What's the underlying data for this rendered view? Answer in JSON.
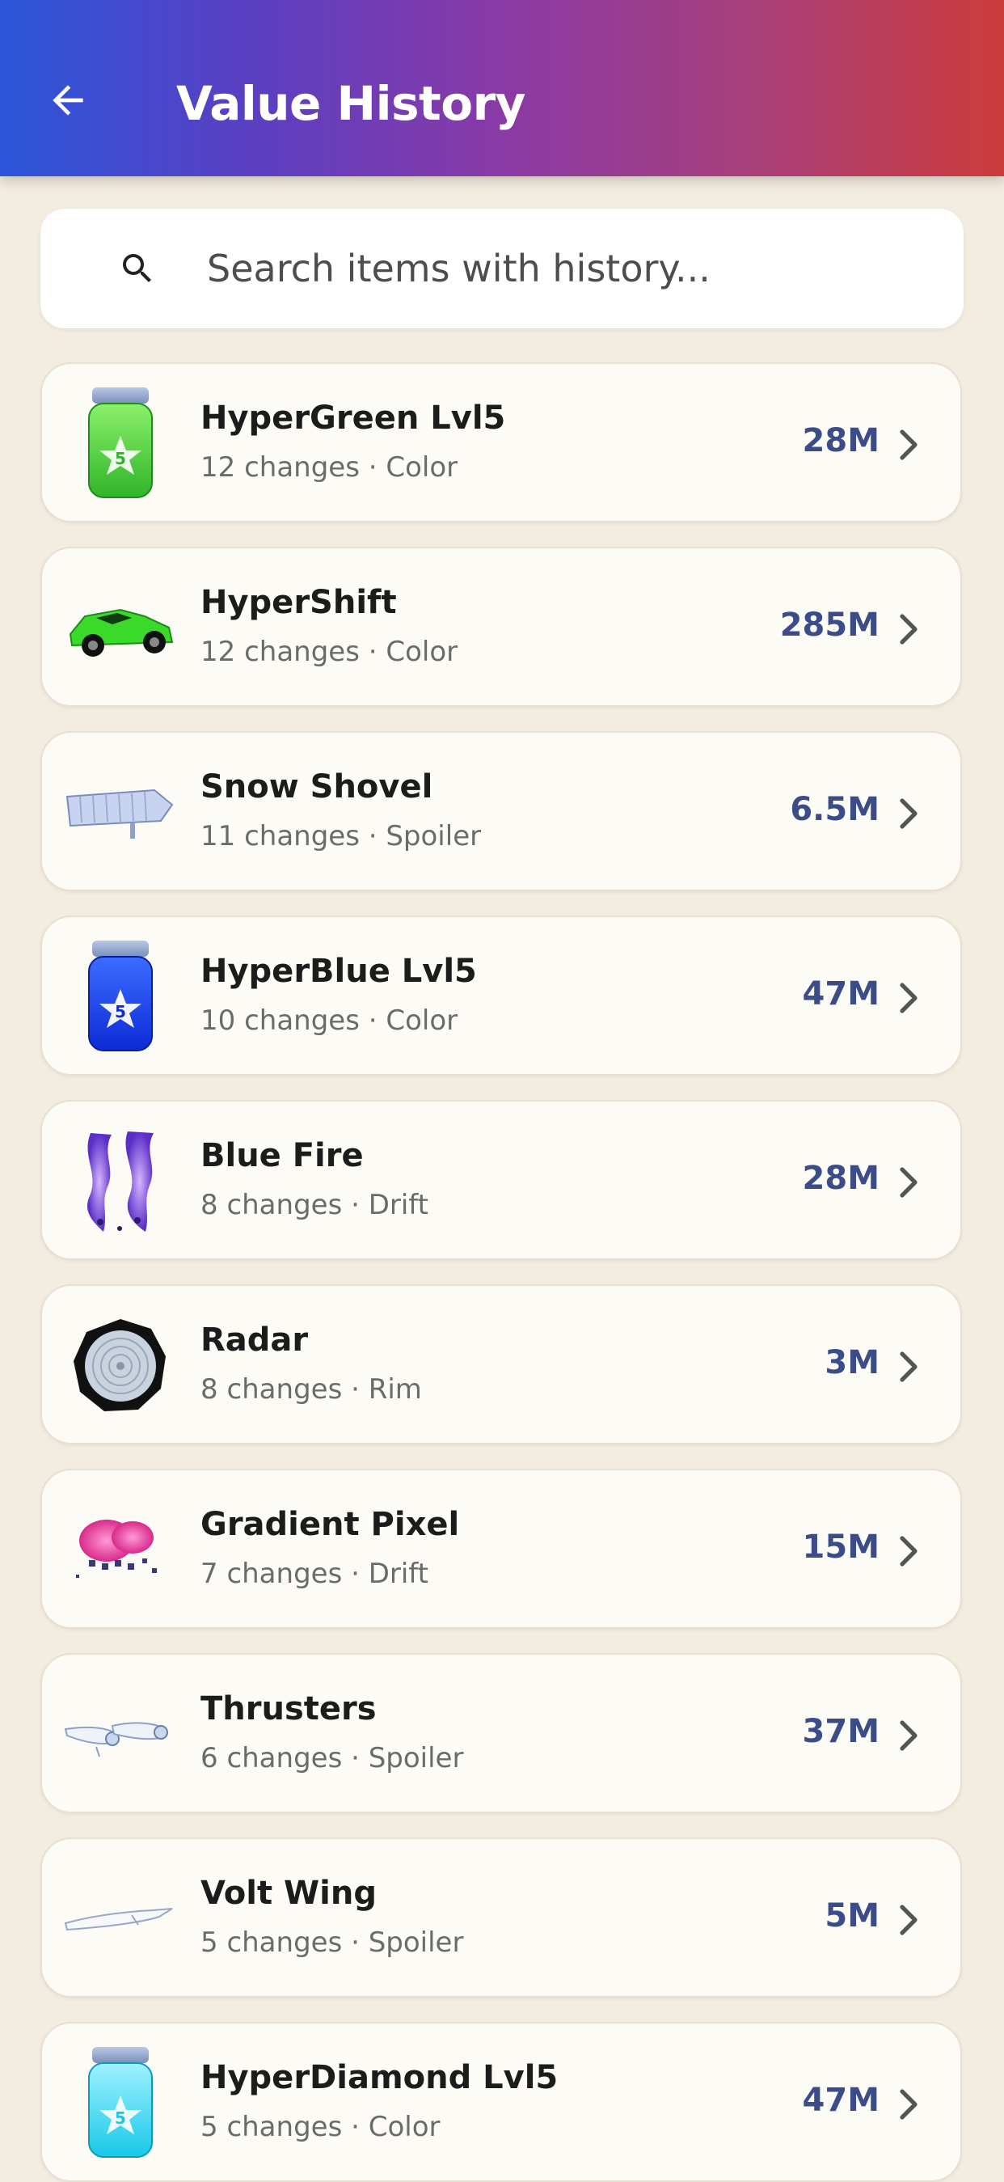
{
  "app_bar": {
    "title": "Value History",
    "back_icon": "arrow-left-icon",
    "background_gradient": [
      "#2b56da",
      "#8a3aa6",
      "#cc3b3b"
    ]
  },
  "search": {
    "placeholder": "Search items with history...",
    "value": "",
    "icon": "search-icon"
  },
  "colors": {
    "background": "#f3ece0",
    "card": "#fdfbf6",
    "value_text": "#3b4d88"
  },
  "items": [
    {
      "name": "HyperGreen Lvl5",
      "meta": "12 changes · Color",
      "value": "28M",
      "thumb": "green-jar-icon"
    },
    {
      "name": "HyperShift",
      "meta": "12 changes · Color",
      "value": "285M",
      "thumb": "green-car-icon"
    },
    {
      "name": "Snow Shovel",
      "meta": "11 changes · Spoiler",
      "value": "6.5M",
      "thumb": "shovel-spoiler-icon"
    },
    {
      "name": "HyperBlue Lvl5",
      "meta": "10 changes · Color",
      "value": "47M",
      "thumb": "blue-jar-icon"
    },
    {
      "name": "Blue Fire",
      "meta": "8 changes · Drift",
      "value": "28M",
      "thumb": "blue-fire-drift-icon"
    },
    {
      "name": "Radar",
      "meta": "8 changes · Rim",
      "value": "3M",
      "thumb": "radar-rim-icon"
    },
    {
      "name": "Gradient Pixel",
      "meta": "7 changes · Drift",
      "value": "15M",
      "thumb": "pink-pixel-drift-icon"
    },
    {
      "name": "Thrusters",
      "meta": "6 changes · Spoiler",
      "value": "37M",
      "thumb": "thrusters-spoiler-icon"
    },
    {
      "name": "Volt Wing",
      "meta": "5 changes · Spoiler",
      "value": "5M",
      "thumb": "volt-wing-icon"
    },
    {
      "name": "HyperDiamond Lvl5",
      "meta": "5 changes · Color",
      "value": "47M",
      "thumb": "diamond-jar-icon"
    }
  ]
}
